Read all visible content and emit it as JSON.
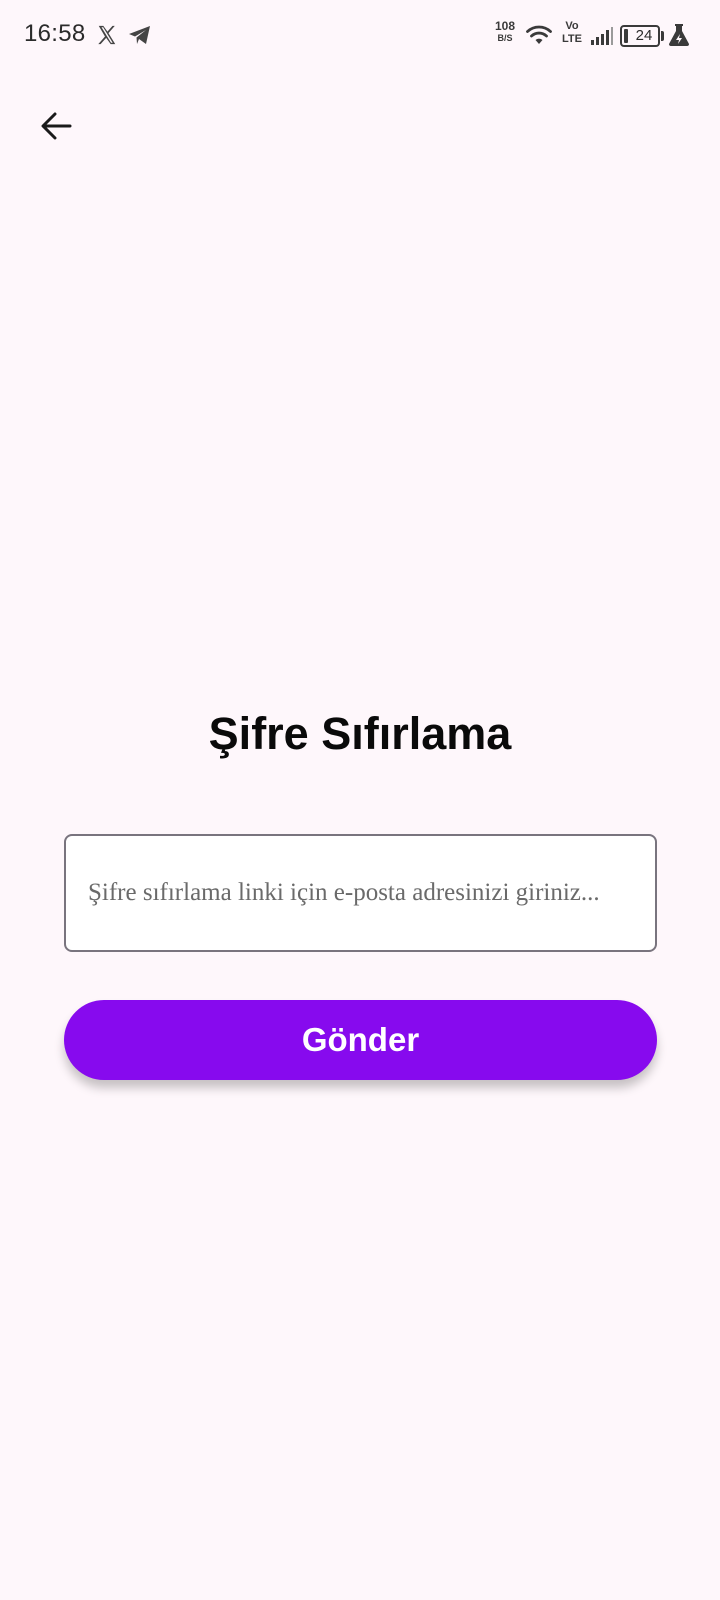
{
  "status_bar": {
    "time": "16:58",
    "network_speed_value": "108",
    "network_speed_unit": "B/S",
    "volte_top": "Vo",
    "volte_bottom": "LTE",
    "battery_level": "24"
  },
  "header": {
    "back_icon": "arrow-left-icon"
  },
  "main": {
    "title": "Şifre Sıfırlama",
    "email_placeholder": "Şifre sıfırlama linki için e-posta adresinizi giriniz...",
    "email_value": "",
    "submit_label": "Gönder"
  },
  "colors": {
    "background": "#fef7fb",
    "accent": "#870aee",
    "field_border": "#79747e"
  }
}
